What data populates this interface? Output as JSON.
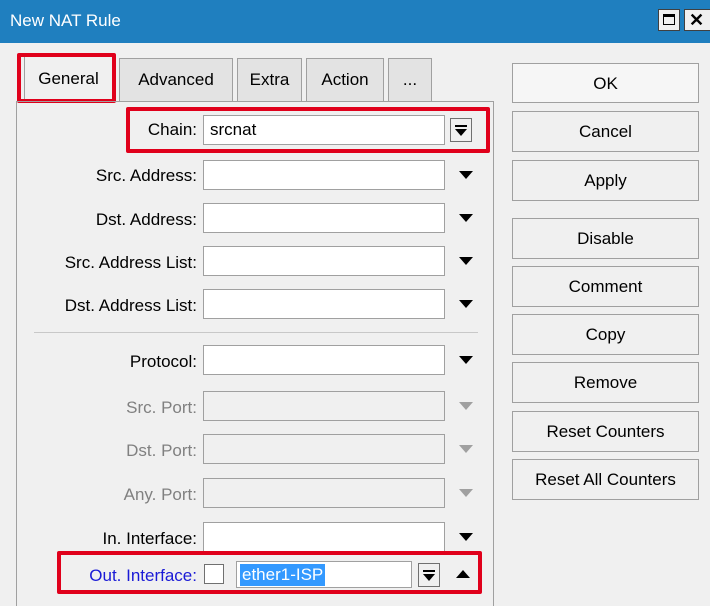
{
  "window": {
    "title": "New NAT Rule"
  },
  "tabs": [
    {
      "label": "General",
      "active": true
    },
    {
      "label": "Advanced"
    },
    {
      "label": "Extra"
    },
    {
      "label": "Action"
    },
    {
      "label": "..."
    }
  ],
  "form": {
    "chain": {
      "label": "Chain:",
      "value": "srcnat"
    },
    "src_address": {
      "label": "Src. Address:",
      "value": ""
    },
    "dst_address": {
      "label": "Dst. Address:",
      "value": ""
    },
    "src_address_list": {
      "label": "Src. Address List:",
      "value": ""
    },
    "dst_address_list": {
      "label": "Dst. Address List:",
      "value": ""
    },
    "protocol": {
      "label": "Protocol:",
      "value": ""
    },
    "src_port": {
      "label": "Src. Port:",
      "value": ""
    },
    "dst_port": {
      "label": "Dst. Port:",
      "value": ""
    },
    "any_port": {
      "label": "Any. Port:",
      "value": ""
    },
    "in_interface": {
      "label": "In. Interface:",
      "value": ""
    },
    "out_interface": {
      "label": "Out. Interface:",
      "value": "ether1-ISP",
      "negate_checked": false
    }
  },
  "buttons": {
    "ok": "OK",
    "cancel": "Cancel",
    "apply": "Apply",
    "disable": "Disable",
    "comment": "Comment",
    "copy": "Copy",
    "remove": "Remove",
    "reset_counters": "Reset Counters",
    "reset_all_counters": "Reset All Counters"
  },
  "colors": {
    "titlebar": "#1f7fbf",
    "highlight": "#e0001b",
    "selection": "#3399ff",
    "link_label": "#1a1ad6"
  }
}
